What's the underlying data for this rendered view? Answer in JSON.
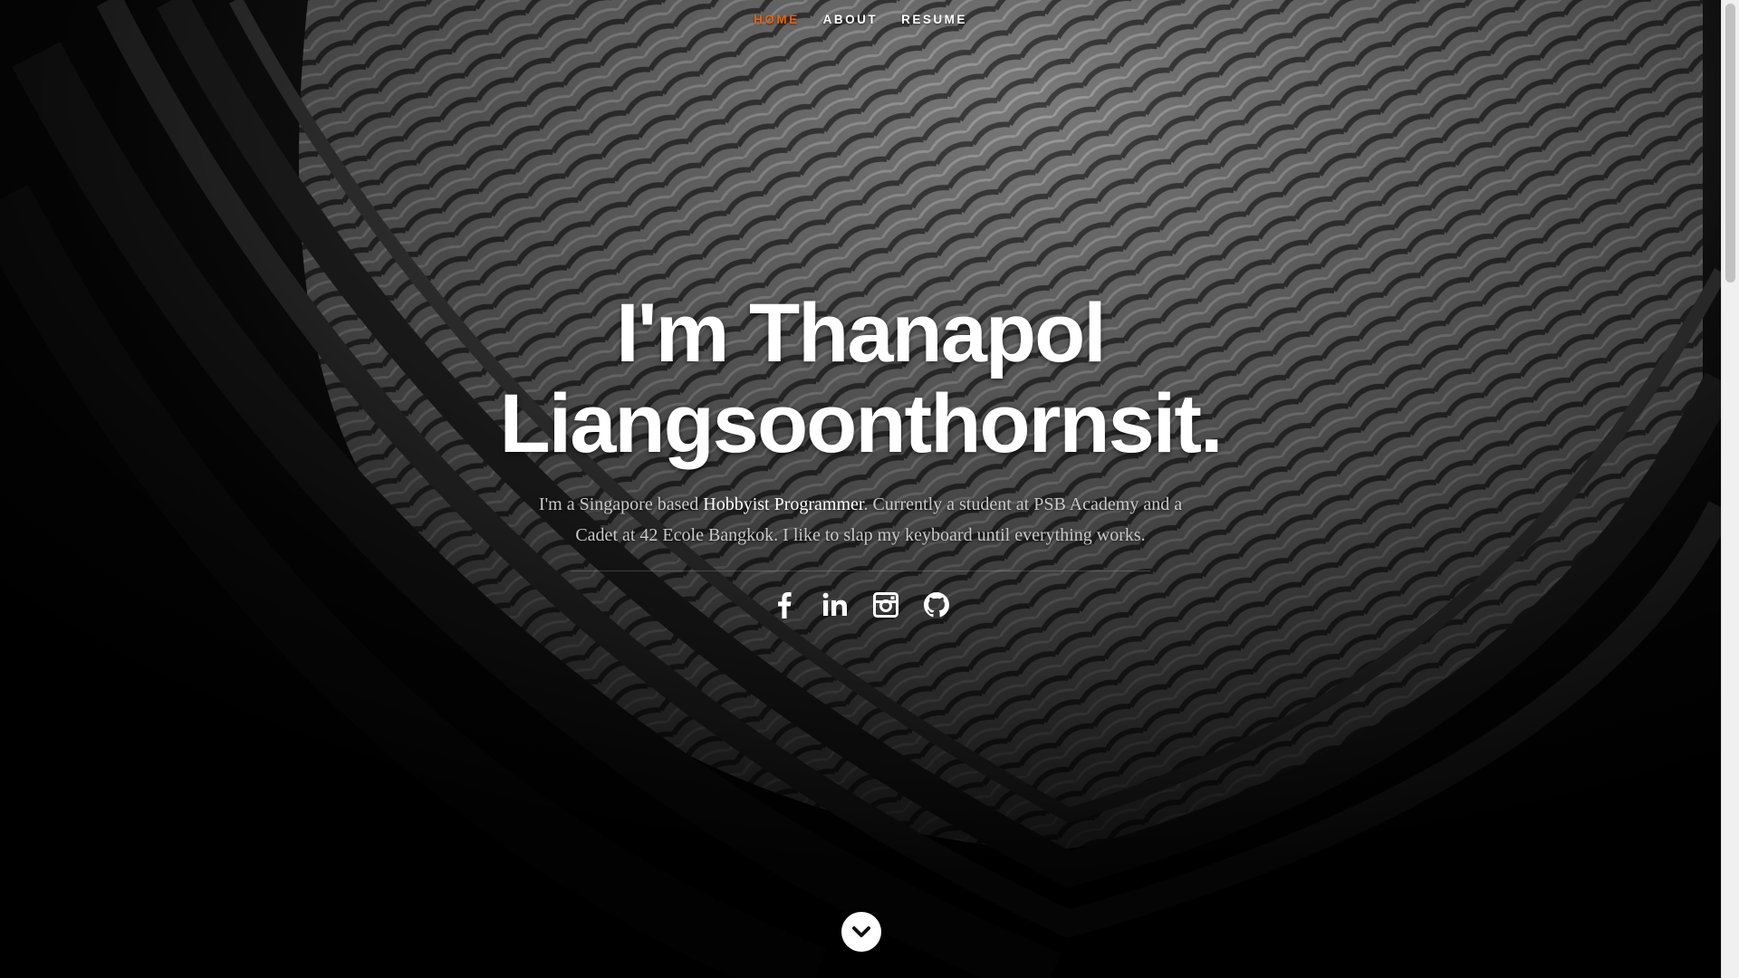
{
  "nav": {
    "items": [
      {
        "label": "HOME",
        "current": true
      },
      {
        "label": "ABOUT",
        "current": false
      },
      {
        "label": "RESUME",
        "current": false
      }
    ],
    "accent_color": "#F06000"
  },
  "hero": {
    "headline": "I'm Thanapol Liangsoonthornsit.",
    "intro_before": "I'm a Singapore based ",
    "intro_highlight": "Hobbyist Programmer",
    "intro_after": ". Currently a student at PSB Academy and a Cadet at 42 Ecole Bangkok. I like to slap my keyboard until everything works."
  },
  "social": [
    {
      "name": "facebook",
      "icon": "facebook-icon"
    },
    {
      "name": "linkedin",
      "icon": "linkedin-icon"
    },
    {
      "name": "instagram",
      "icon": "instagram-icon"
    },
    {
      "name": "github",
      "icon": "github-icon"
    }
  ],
  "scroll_down": {
    "icon": "chevron-down-icon"
  }
}
